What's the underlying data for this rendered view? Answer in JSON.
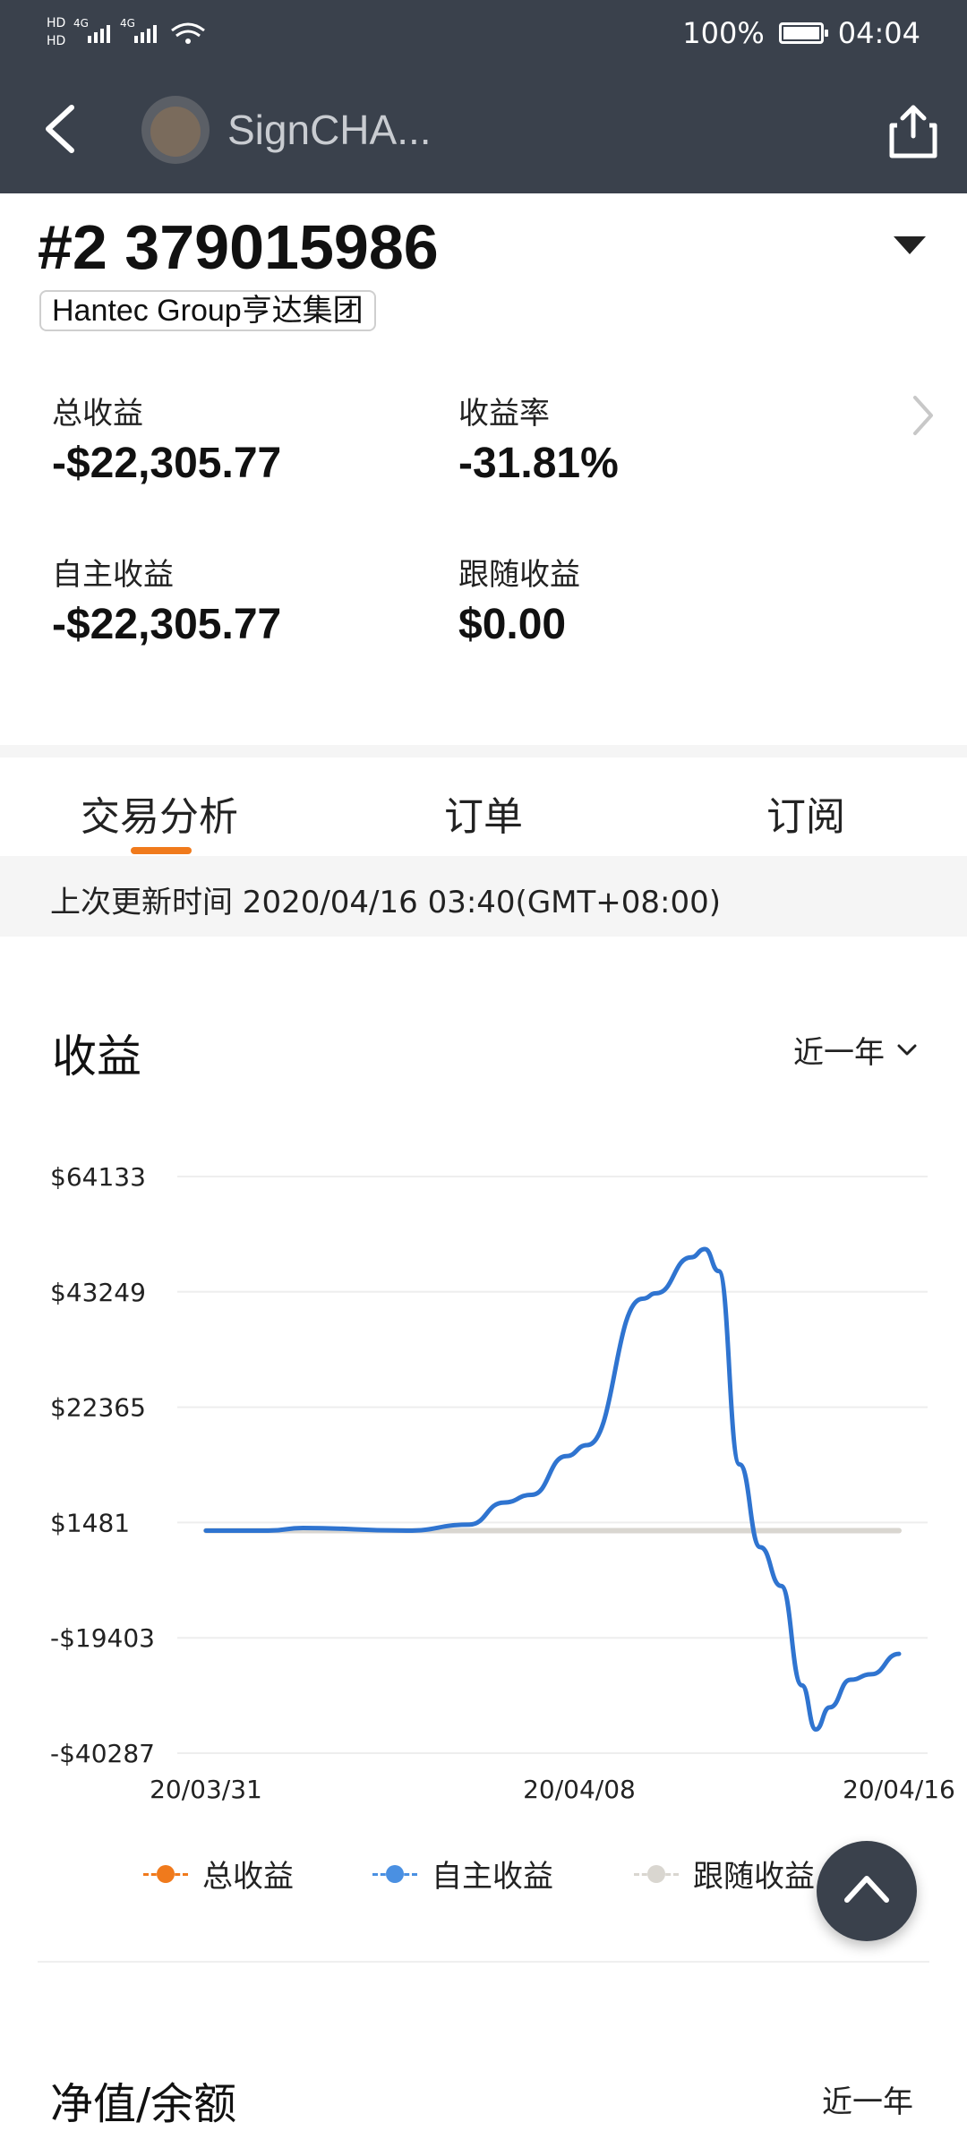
{
  "status_bar": {
    "battery": "100%",
    "time": "04:04",
    "battery_level": 1.0
  },
  "app_bar": {
    "title": "SignCHA...",
    "icons": [
      "back-icon",
      "share-icon"
    ]
  },
  "account": {
    "title": "#2 379015986",
    "broker": "Hantec Group亨达集团"
  },
  "stats": {
    "total_label": "总收益",
    "total_value": "-$22,305.77",
    "rate_label": "收益率",
    "rate_value": "-31.81%",
    "self_label": "自主收益",
    "self_value": "-$22,305.77",
    "follow_label": "跟随收益",
    "follow_value": "$0.00"
  },
  "tabs": {
    "items": [
      "交易分析",
      "订单",
      "订阅"
    ],
    "active": 0
  },
  "update": {
    "text": "上次更新时间 2020/04/16 03:40(GMT+08:00)"
  },
  "section": {
    "title": "收益",
    "period": "近一年"
  },
  "chart_data": {
    "type": "line",
    "title": "",
    "y_ticks": [
      "$64133",
      "$43249",
      "$22365",
      "$1481",
      "-$19403",
      "-$40287"
    ],
    "ylim": [
      -40287,
      64133
    ],
    "x_ticks": [
      "20/03/31",
      "20/04/08",
      "20/04/16"
    ],
    "series": [
      {
        "name": "自主收益",
        "color": "#2f74d0",
        "points": [
          [
            0,
            0
          ],
          [
            0.09,
            0
          ],
          [
            0.14,
            500
          ],
          [
            0.29,
            0
          ],
          [
            0.38,
            1100
          ],
          [
            0.43,
            5100
          ],
          [
            0.47,
            6500
          ],
          [
            0.52,
            13500
          ],
          [
            0.55,
            15500
          ],
          [
            0.63,
            42000
          ],
          [
            0.65,
            43000
          ],
          [
            0.7,
            49500
          ],
          [
            0.72,
            51000
          ],
          [
            0.74,
            47000
          ],
          [
            0.77,
            12000
          ],
          [
            0.8,
            -3000
          ],
          [
            0.83,
            -10000
          ],
          [
            0.86,
            -28000
          ],
          [
            0.88,
            -36000
          ],
          [
            0.9,
            -32000
          ],
          [
            0.93,
            -27000
          ],
          [
            0.96,
            -26000
          ],
          [
            1,
            -22305
          ]
        ]
      },
      {
        "name": "跟随收益",
        "color": "#d9d6d0",
        "points": [
          [
            0,
            0
          ],
          [
            1,
            0
          ]
        ]
      }
    ],
    "legend": [
      {
        "label": "总收益",
        "color": "#f07a1c"
      },
      {
        "label": "自主收益",
        "color": "#4a90e2"
      },
      {
        "label": "跟随收益",
        "color": "#d9d6d0"
      }
    ],
    "grid": true
  },
  "next_section": {
    "title": "净值/余额",
    "period": "近一年"
  },
  "fab": {
    "icon": "chevron-up-icon"
  }
}
